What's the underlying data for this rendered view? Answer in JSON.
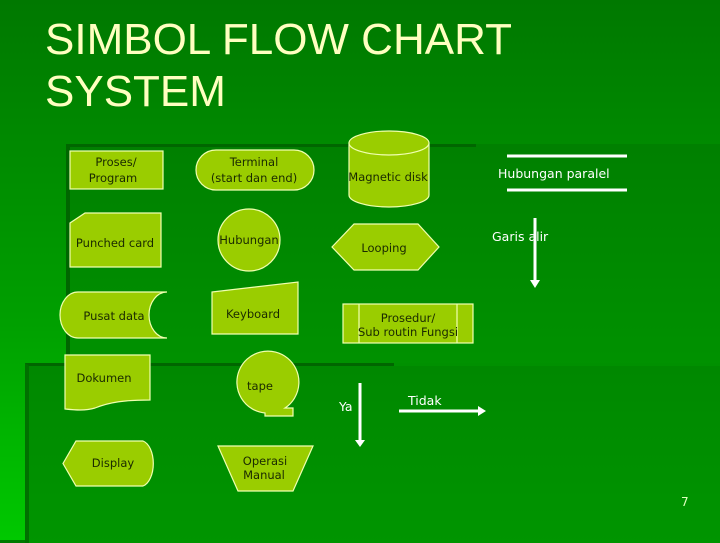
{
  "slide": {
    "title_line1": "SIMBOL FLOW CHART",
    "title_line2": "SYSTEM",
    "page_number": "7"
  },
  "symbols": {
    "proses_program": {
      "line1": "Proses/",
      "line2": "Program",
      "shape": "rectangle"
    },
    "terminal": {
      "line1": "Terminal",
      "line2": "(start dan end)",
      "shape": "rounded-rectangle"
    },
    "magnetic_disk": {
      "label": "Magnetic disk",
      "shape": "cylinder"
    },
    "punched_card": {
      "label": "Punched card",
      "shape": "clipped-corner-rectangle"
    },
    "hubungan": {
      "label": "Hubungan",
      "shape": "circle"
    },
    "looping": {
      "label": "Looping",
      "shape": "hexagon"
    },
    "pusat_data": {
      "label": "Pusat data",
      "shape": "stored-data"
    },
    "keyboard": {
      "label": "Keyboard",
      "shape": "manual-input"
    },
    "prosedur": {
      "line1": "Prosedur/",
      "line2": "Sub routin Fungsi",
      "shape": "predefined-process"
    },
    "dokumen": {
      "label": "Dokumen",
      "shape": "document"
    },
    "tape": {
      "label": "tape",
      "shape": "sequential-access"
    },
    "display": {
      "label": "Display",
      "shape": "display"
    },
    "operasi_manual": {
      "line1": "Operasi",
      "line2": "Manual",
      "shape": "trapezoid"
    }
  },
  "connectors": {
    "hubungan_paralel": {
      "label": "Hubungan paralel"
    },
    "garis_alir": {
      "label": "Garis alir"
    },
    "ya": {
      "label": "Ya"
    },
    "tidak": {
      "label": "Tidak"
    }
  },
  "colors": {
    "shape_fill": "#9acd00",
    "shape_stroke": "#f0ffb0",
    "title_text": "#ffffc0",
    "background": "#008800"
  }
}
